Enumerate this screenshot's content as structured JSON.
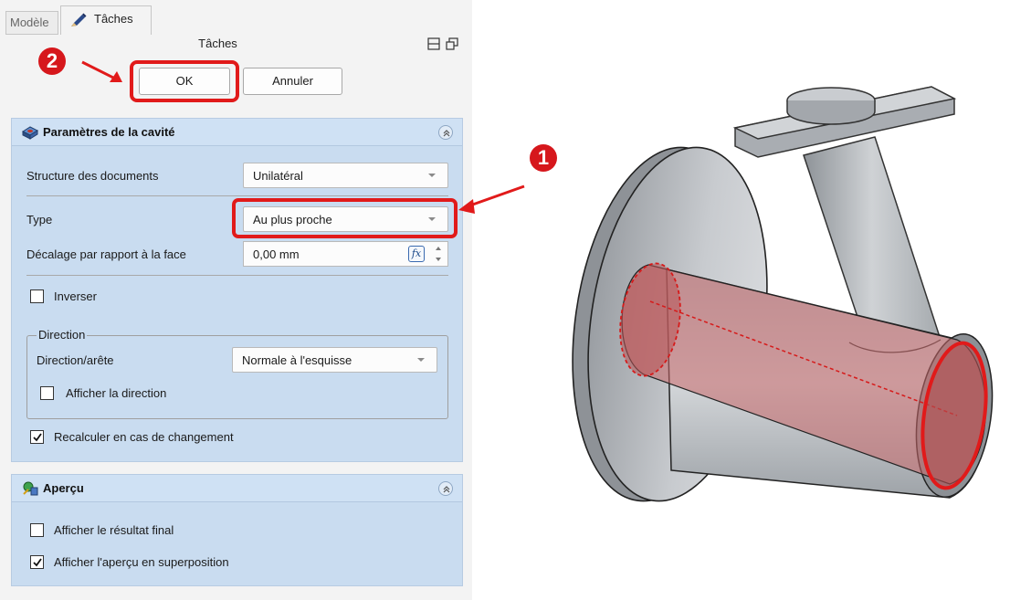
{
  "tabs": {
    "modele": "Modèle",
    "taches": "Tâches"
  },
  "panel": {
    "title": "Tâches"
  },
  "buttons": {
    "ok": "OK",
    "cancel": "Annuler"
  },
  "callouts": {
    "step1": "1",
    "step2": "2"
  },
  "params": {
    "title": "Paramètres de la cavité",
    "structure_label": "Structure des documents",
    "structure_value": "Unilatéral",
    "type_label": "Type",
    "type_value": "Au plus proche",
    "offset_label": "Décalage par rapport à la face",
    "offset_value": "0,00 mm",
    "inverse_label": "Inverser",
    "inverse_checked": false,
    "direction_group": "Direction",
    "direction_label": "Direction/arête",
    "direction_value": "Normale à l'esquisse",
    "show_direction_label": "Afficher la direction",
    "show_direction_checked": false,
    "recompute_label": "Recalculer en cas de changement",
    "recompute_checked": true
  },
  "apercu": {
    "title": "Aperçu",
    "final_label": "Afficher le résultat final",
    "final_checked": false,
    "overlay_label": "Afficher l'aperçu en superposition",
    "overlay_checked": true
  },
  "colors": {
    "accent_red": "#e11a1a",
    "section_bg": "#c9dcf0",
    "preview_red": "#c8686a"
  },
  "icons": [
    "pen-icon",
    "float-icon",
    "restore-icon",
    "pocket-icon",
    "collapse-icon",
    "preview-icon",
    "fx-icon",
    "checkmark-icon"
  ]
}
